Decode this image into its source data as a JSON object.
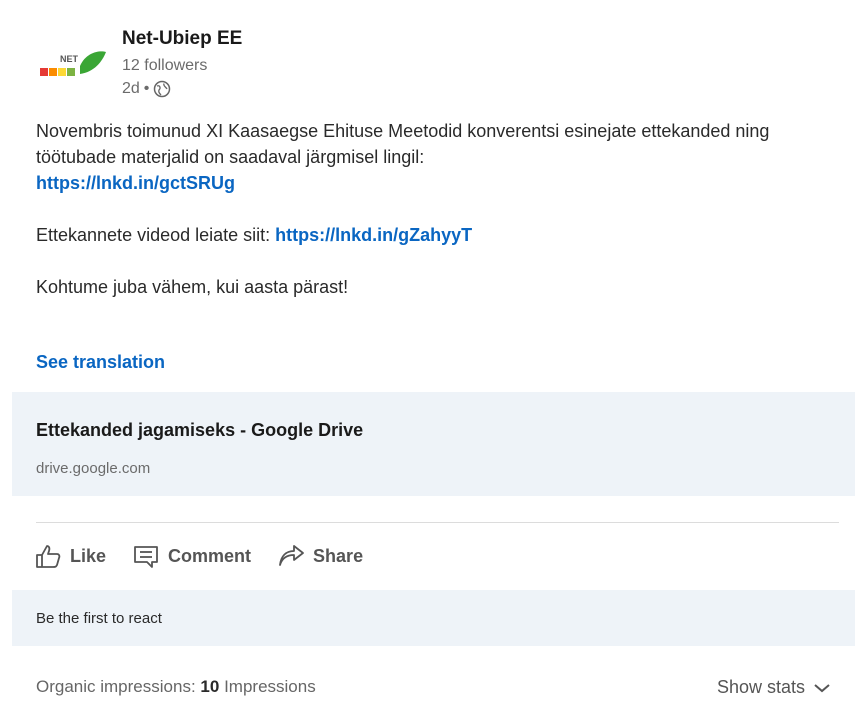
{
  "post": {
    "org_name": "Net-Ubiep EE",
    "followers": "12 followers",
    "age": "2d",
    "separator": "•",
    "logo_text": "NET",
    "icons": {
      "logo": "net-ubiep-logo",
      "visibility": "globe-icon"
    }
  },
  "body": {
    "line1": "Novembris toimunud XI Kaasaegse Ehituse Meetodid konverentsi esinejate ettekanded ning töötubade materjalid on saadaval järgmisel lingil:",
    "link1": "https://lnkd.in/gctSRUg",
    "line2_prefix": "Ettekannete videod leiate siit:",
    "link2": "https://lnkd.in/gZahyyT",
    "line3": "Kohtume juba vähem, kui aasta pärast!",
    "see_translation": "See translation"
  },
  "link_card": {
    "title": "Ettekanded jagamiseks - Google Drive",
    "domain": "drive.google.com"
  },
  "actions": {
    "like": "Like",
    "comment": "Comment",
    "share": "Share",
    "icons": {
      "like": "thumbs-up-icon",
      "comment": "comment-icon",
      "share": "share-arrow-icon"
    }
  },
  "reactions": {
    "text": "Be the first to react"
  },
  "stats": {
    "label": "Organic impressions:",
    "value": "10",
    "unit": "Impressions",
    "show_stats": "Show stats",
    "icons": {
      "toggle": "chevron-down-icon"
    }
  },
  "colors": {
    "link": "#0a66c2",
    "panel": "#eef3f8"
  }
}
